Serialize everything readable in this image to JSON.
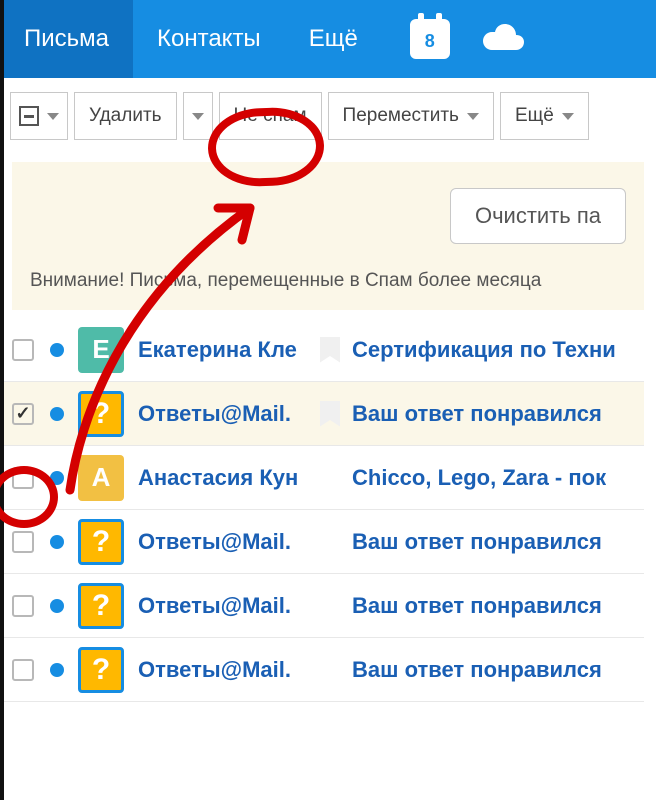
{
  "topnav": {
    "mail": "Письма",
    "contacts": "Контакты",
    "more": "Ещё",
    "calendar_day": "8"
  },
  "toolbar": {
    "delete": "Удалить",
    "not_spam": "Не спам",
    "move": "Переместить",
    "more": "Ещё"
  },
  "panel": {
    "clear_button": "Очистить па",
    "warning": "Внимание! Письма, перемещенные в Спам более месяца"
  },
  "messages": [
    {
      "sender": "Екатерина Кле",
      "subject": "Сертификация по Техни",
      "avatar_letter": "Е",
      "avatar_class": "av-teal",
      "checked": false,
      "show_bookmark": true
    },
    {
      "sender": "Ответы@Mail.",
      "subject": "Ваш ответ понравился",
      "avatar_letter": "?",
      "avatar_class": "av-q",
      "checked": true,
      "show_bookmark": true
    },
    {
      "sender": "Анастасия Кун",
      "subject": "Chicco, Lego, Zara - пок",
      "avatar_letter": "А",
      "avatar_class": "av-yellow",
      "checked": false,
      "show_bookmark": false
    },
    {
      "sender": "Ответы@Mail.",
      "subject": "Ваш ответ понравился",
      "avatar_letter": "?",
      "avatar_class": "av-q",
      "checked": false,
      "show_bookmark": false
    },
    {
      "sender": "Ответы@Mail.",
      "subject": "Ваш ответ понравился",
      "avatar_letter": "?",
      "avatar_class": "av-q",
      "checked": false,
      "show_bookmark": false
    },
    {
      "sender": "Ответы@Mail.",
      "subject": "Ваш ответ понравился",
      "avatar_letter": "?",
      "avatar_class": "av-q",
      "checked": false,
      "show_bookmark": false
    }
  ]
}
